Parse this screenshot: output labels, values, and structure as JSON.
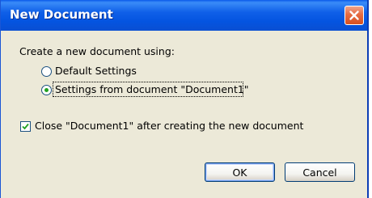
{
  "window": {
    "title": "New Document"
  },
  "dialog": {
    "prompt": "Create a new document using:",
    "options": [
      {
        "label": "Default Settings",
        "selected": false
      },
      {
        "label": "Settings from document \"Document1\"",
        "selected": true
      }
    ],
    "close_checkbox": {
      "label": "Close \"Document1\" after creating the new document",
      "checked": true
    }
  },
  "buttons": {
    "ok": "OK",
    "cancel": "Cancel"
  },
  "colors": {
    "title_bar": "#0454e0",
    "dialog_bg": "#ece9d8",
    "radio_dot": "#21a121",
    "check_mark": "#21a121",
    "close_button": "#e66b42"
  }
}
